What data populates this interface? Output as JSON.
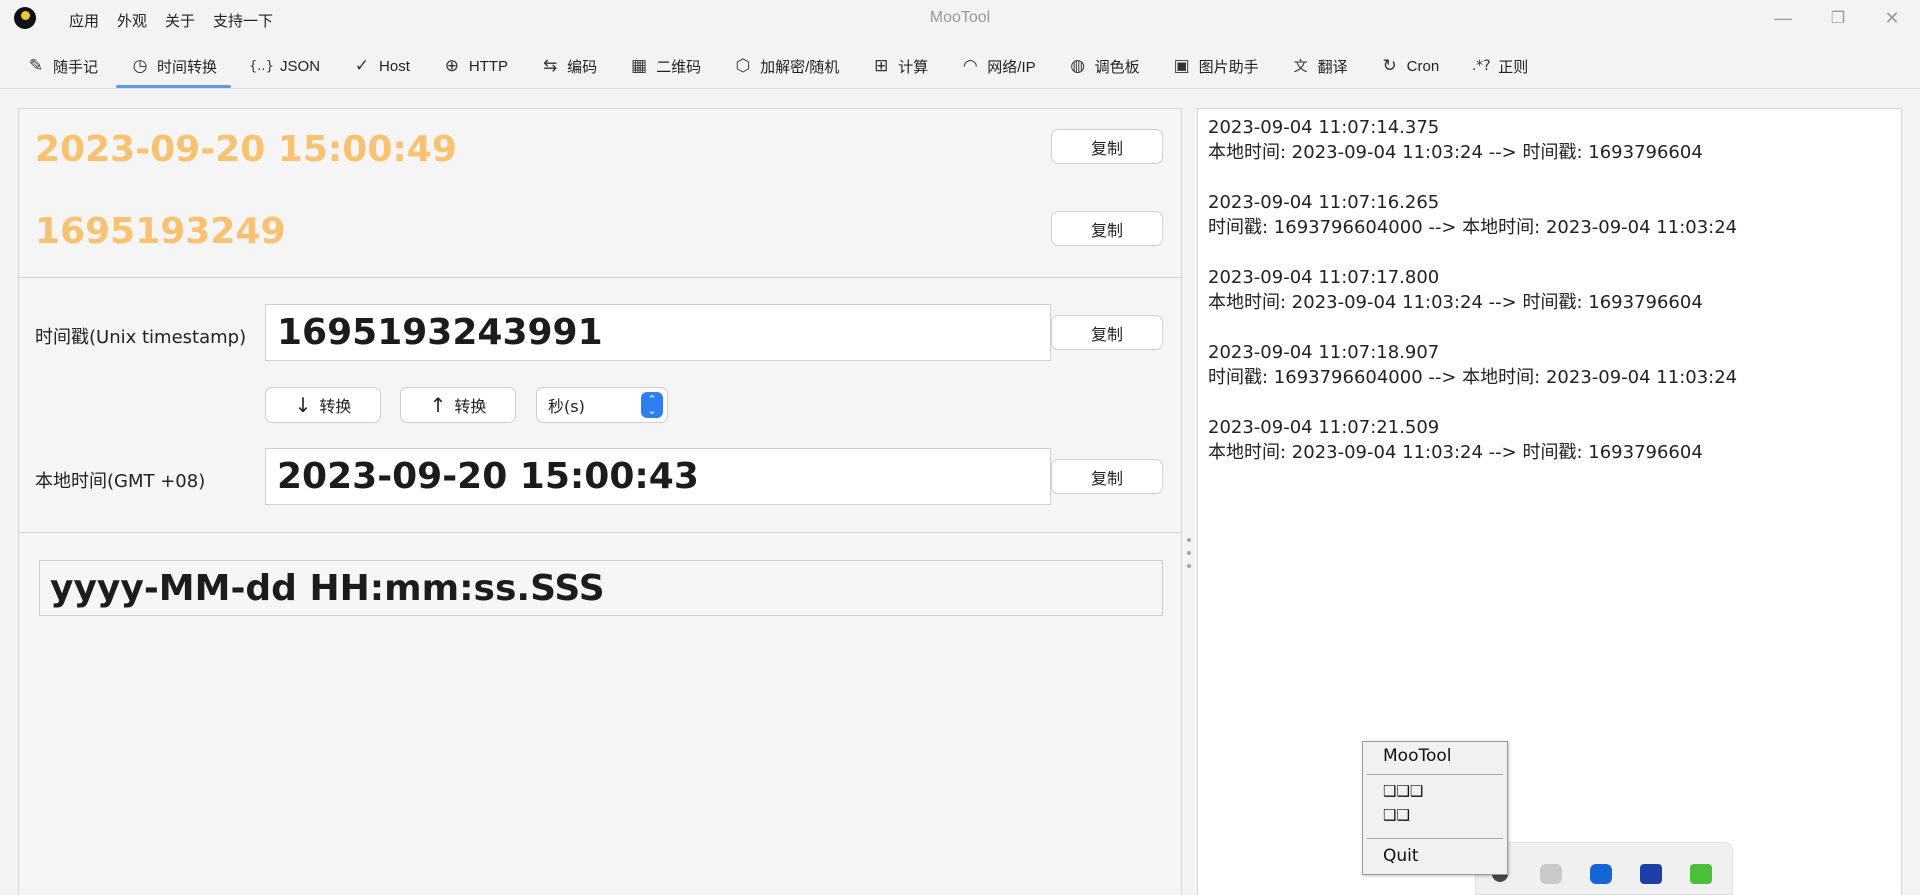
{
  "app": {
    "title": "MooTool",
    "menu": [
      "应用",
      "外观",
      "关于",
      "支持一下"
    ]
  },
  "window_controls": {
    "minimize": "—",
    "restore": "❐",
    "close": "✕"
  },
  "tabs": [
    {
      "label": "随手记",
      "icon": "✎",
      "icon_name": "pencil-icon"
    },
    {
      "label": "时间转换",
      "icon": "◷",
      "icon_name": "clock-icon",
      "active": true
    },
    {
      "label": "JSON",
      "icon": "{..}",
      "icon_name": "braces-icon"
    },
    {
      "label": "Host",
      "icon": "✓",
      "icon_name": "check-icon"
    },
    {
      "label": "HTTP",
      "icon": "⊕",
      "icon_name": "globe-icon"
    },
    {
      "label": "编码",
      "icon": "⇆",
      "icon_name": "swap-icon"
    },
    {
      "label": "二维码",
      "icon": "▦",
      "icon_name": "qrcode-icon"
    },
    {
      "label": "加解密/随机",
      "icon": "⬡",
      "icon_name": "cube-icon"
    },
    {
      "label": "计算",
      "icon": "⊞",
      "icon_name": "calculator-icon"
    },
    {
      "label": "网络/IP",
      "icon": "◠",
      "icon_name": "wifi-icon"
    },
    {
      "label": "调色板",
      "icon": "◍",
      "icon_name": "palette-icon"
    },
    {
      "label": "图片助手",
      "icon": "▣",
      "icon_name": "image-icon"
    },
    {
      "label": "翻译",
      "icon": "文",
      "icon_name": "translate-icon"
    },
    {
      "label": "Cron",
      "icon": "↻",
      "icon_name": "cron-icon"
    },
    {
      "label": "正则",
      "icon": ".*?",
      "icon_name": "regex-icon"
    }
  ],
  "current": {
    "datetime": "2023-09-20 15:00:49",
    "timestamp": "1695193249",
    "copy_label": "复制"
  },
  "converter": {
    "timestamp_label": "时间戳(Unix timestamp)",
    "timestamp_value": "1695193243991",
    "to_local_label": "转换",
    "to_timestamp_label": "转换",
    "unit_selected": "秒(s)",
    "local_label": "本地时间(GMT +08)",
    "local_value": "2023-09-20 15:00:43",
    "copy_label": "复制"
  },
  "format": "yyyy-MM-dd HH:mm:ss.SSS",
  "history": [
    {
      "time": "2023-09-04 11:07:14.375",
      "detail": "本地时间: 2023-09-04 11:03:24 --> 时间戳: 1693796604"
    },
    {
      "time": "2023-09-04 11:07:16.265",
      "detail": "时间戳: 1693796604000 --> 本地时间: 2023-09-04 11:03:24"
    },
    {
      "time": "2023-09-04 11:07:17.800",
      "detail": "本地时间: 2023-09-04 11:03:24 --> 时间戳: 1693796604"
    },
    {
      "time": "2023-09-04 11:07:18.907",
      "detail": "时间戳: 1693796604000 --> 本地时间: 2023-09-04 11:03:24"
    },
    {
      "time": "2023-09-04 11:07:21.509",
      "detail": "本地时间: 2023-09-04 11:03:24 --> 时间戳: 1693796604"
    }
  ],
  "tray_menu": {
    "title": "MooTool",
    "item_1": "❑❑❑",
    "item_2": "❑❑",
    "quit": "Quit"
  },
  "colors": {
    "accent": "#5b9be6",
    "highlight_text": "#f9c272",
    "select_blue": "#2f7ff2"
  }
}
